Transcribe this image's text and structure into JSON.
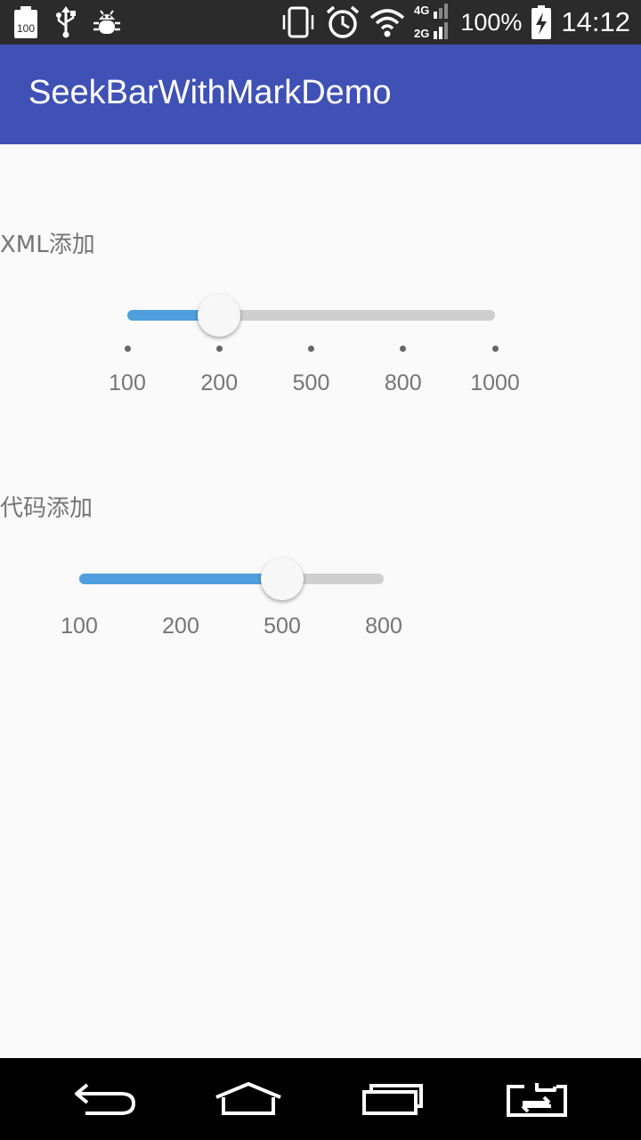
{
  "status_bar": {
    "icons_left": [
      "battery-100-icon",
      "usb-icon",
      "debug-bug-icon"
    ],
    "battery_badge": "100",
    "icons_right": [
      "vibrate-icon",
      "alarm-icon",
      "wifi-icon",
      "signal-icon",
      "battery-charging-icon"
    ],
    "network_top": "4G",
    "network_bottom": "2G",
    "battery_percent": "100%",
    "time": "14:12"
  },
  "app_bar": {
    "title": "SeekBarWithMarkDemo"
  },
  "sections": [
    {
      "label": "XML添加",
      "marks": [
        "100",
        "200",
        "500",
        "800",
        "1000"
      ],
      "selected_index": 1,
      "show_dots": true
    },
    {
      "label": "代码添加",
      "marks": [
        "100",
        "200",
        "500",
        "800"
      ],
      "selected_index": 2,
      "show_dots": false
    }
  ],
  "colors": {
    "primary": "#3f51b5",
    "accent_progress": "#4f9fdc",
    "track": "#cfcfcf",
    "status_bar": "#2b2b2b",
    "nav_bar": "#000000"
  },
  "nav_bar": {
    "buttons": [
      "back-icon",
      "home-icon",
      "recents-icon",
      "switch-icon"
    ]
  }
}
